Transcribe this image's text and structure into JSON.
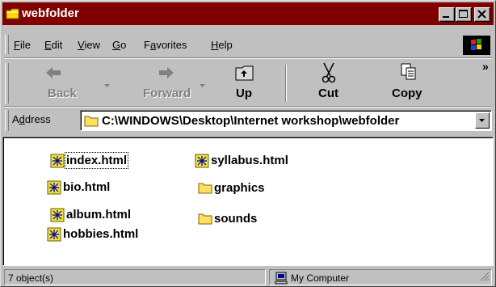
{
  "window": {
    "title": "webfolder"
  },
  "menu": {
    "items": [
      {
        "label": "File",
        "accel": "F",
        "rest": "ile"
      },
      {
        "label": "Edit",
        "accel": "E",
        "rest": "dit"
      },
      {
        "label": "View",
        "accel": "V",
        "rest": "iew"
      },
      {
        "label": "Go",
        "accel": "G",
        "rest": "o"
      },
      {
        "label": "Favorites",
        "pre": "F",
        "accel": "a",
        "rest": "vorites"
      },
      {
        "label": "Help",
        "accel": "H",
        "rest": "elp"
      }
    ]
  },
  "toolbar": {
    "back_label": "Back",
    "forward_label": "Forward",
    "up_label": "Up",
    "cut_label": "Cut",
    "copy_label": "Copy",
    "more": "»"
  },
  "address": {
    "label_pre": "A",
    "label_accel": "d",
    "label_rest": "dress",
    "value": "C:\\WINDOWS\\Desktop\\Internet workshop\\webfolder"
  },
  "files": [
    {
      "name": "index.html",
      "type": "html"
    },
    {
      "name": "bio.html",
      "type": "html"
    },
    {
      "name": "album.html",
      "type": "html"
    },
    {
      "name": "hobbies.html",
      "type": "html"
    },
    {
      "name": "syllabus.html",
      "type": "html"
    },
    {
      "name": "graphics",
      "type": "folder"
    },
    {
      "name": "sounds",
      "type": "folder"
    }
  ],
  "status": {
    "count_text": "7 object(s)",
    "zone_text": "My Computer"
  },
  "colors": {
    "titlebar": "#800000",
    "face": "#c0c0c0",
    "content": "#ffffff"
  }
}
